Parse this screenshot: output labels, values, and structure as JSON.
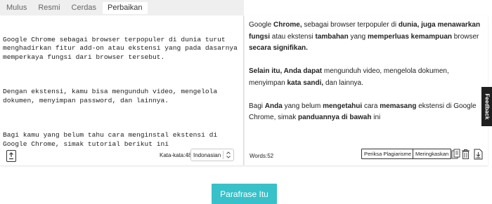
{
  "tabs": [
    {
      "label": "Mulus",
      "active": false
    },
    {
      "label": "Resmi",
      "active": false
    },
    {
      "label": "Cerdas",
      "active": false
    },
    {
      "label": "Perbaikan",
      "active": true
    }
  ],
  "input": {
    "paragraphs": [
      "Google Chrome sebagai browser terpopuler di dunia turut menghadirkan fitur add-on atau ekstensi yang pada dasarnya memperkaya fungsi dari browser tersebut.",
      "Dengan ekstensi, kamu bisa mengunduh video, mengelola dokumen, menyimpan password, dan lainnya.",
      "Bagi kamu yang belum tahu cara menginstal ekstensi di Google Chrome, simak tutorial berikut ini"
    ],
    "word_count_label": "Kata-kata:48",
    "language": "Indonasian",
    "upload_icon": "upload-icon"
  },
  "output": {
    "p1": {
      "s1": "Google ",
      "b1": "Chrome,",
      "s2": " sebagai browser terpopuler di ",
      "b2": "dunia, juga menawarkan fungsi",
      "s3": " atau ekstensi ",
      "b3": "tambahan",
      "s4": " yang ",
      "b4": "memperluas kemampuan",
      "s5": " browser ",
      "b5": "secara signifikan."
    },
    "p2": {
      "s0": " ",
      "b1": "Selain itu, Anda dapat",
      "s1": " mengunduh video, mengelola dokumen, menyimpan ",
      "b2": "kata sandi,",
      "s2": " dan lainnya."
    },
    "p3": {
      "s0": " Bagi ",
      "b1": "Anda",
      "s1": " yang belum ",
      "b2": "mengetahui",
      "s2": " cara ",
      "b3": "memasang",
      "s3": " ekstensi di Google Chrome, simak ",
      "b4": "panduannya di bawah",
      "s4": " ini"
    },
    "words_label": "Words:52",
    "plagiarism_button": "Periksa Plagiarisme",
    "summarize_button": "Meringkaskan",
    "icons": [
      "copy-icon",
      "trash-icon",
      "download-icon"
    ]
  },
  "feedback_label": "Feedback",
  "paraphrase_button": "Parafrase Itu",
  "colors": {
    "accent": "#38c1c9",
    "tabbar": "#efefef",
    "feedback_bg": "#1f1f1f"
  }
}
